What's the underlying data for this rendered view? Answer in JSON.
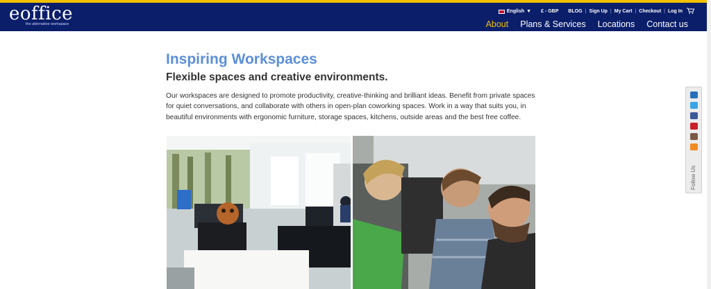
{
  "brand": {
    "logo_text": "eoffice",
    "tagline": "the alternative workspace"
  },
  "utility_bar": {
    "language": "English",
    "currency": "£ - GBP",
    "links": [
      "BLOG",
      "Sign Up",
      "My Cart",
      "Checkout",
      "Log In"
    ]
  },
  "nav": {
    "items": [
      "About",
      "Plans & Services",
      "Locations",
      "Contact us"
    ],
    "active": "About"
  },
  "main": {
    "title": "Inspiring Workspaces",
    "subtitle": "Flexible spaces and creative environments.",
    "body": "Our workspaces are designed to promote productivity, creative-thinking and brilliant ideas. Benefit from private spaces for quiet conversations, and collaborate with others in open-plan coworking spaces. Work in a way that suits you, in beautiful environments with ergonomic furniture, storage spaces, kitchens, outside areas and the best free coffee."
  },
  "social": {
    "label": "Follow Us",
    "icons": [
      "linkedin-icon",
      "twitter-icon",
      "facebook-icon",
      "pinterest-icon",
      "instagram-icon",
      "rss-icon"
    ]
  },
  "colors": {
    "header_bg": "#0b1e6a",
    "accent_yellow": "#f2c000",
    "title_blue": "#5b8fd8"
  }
}
